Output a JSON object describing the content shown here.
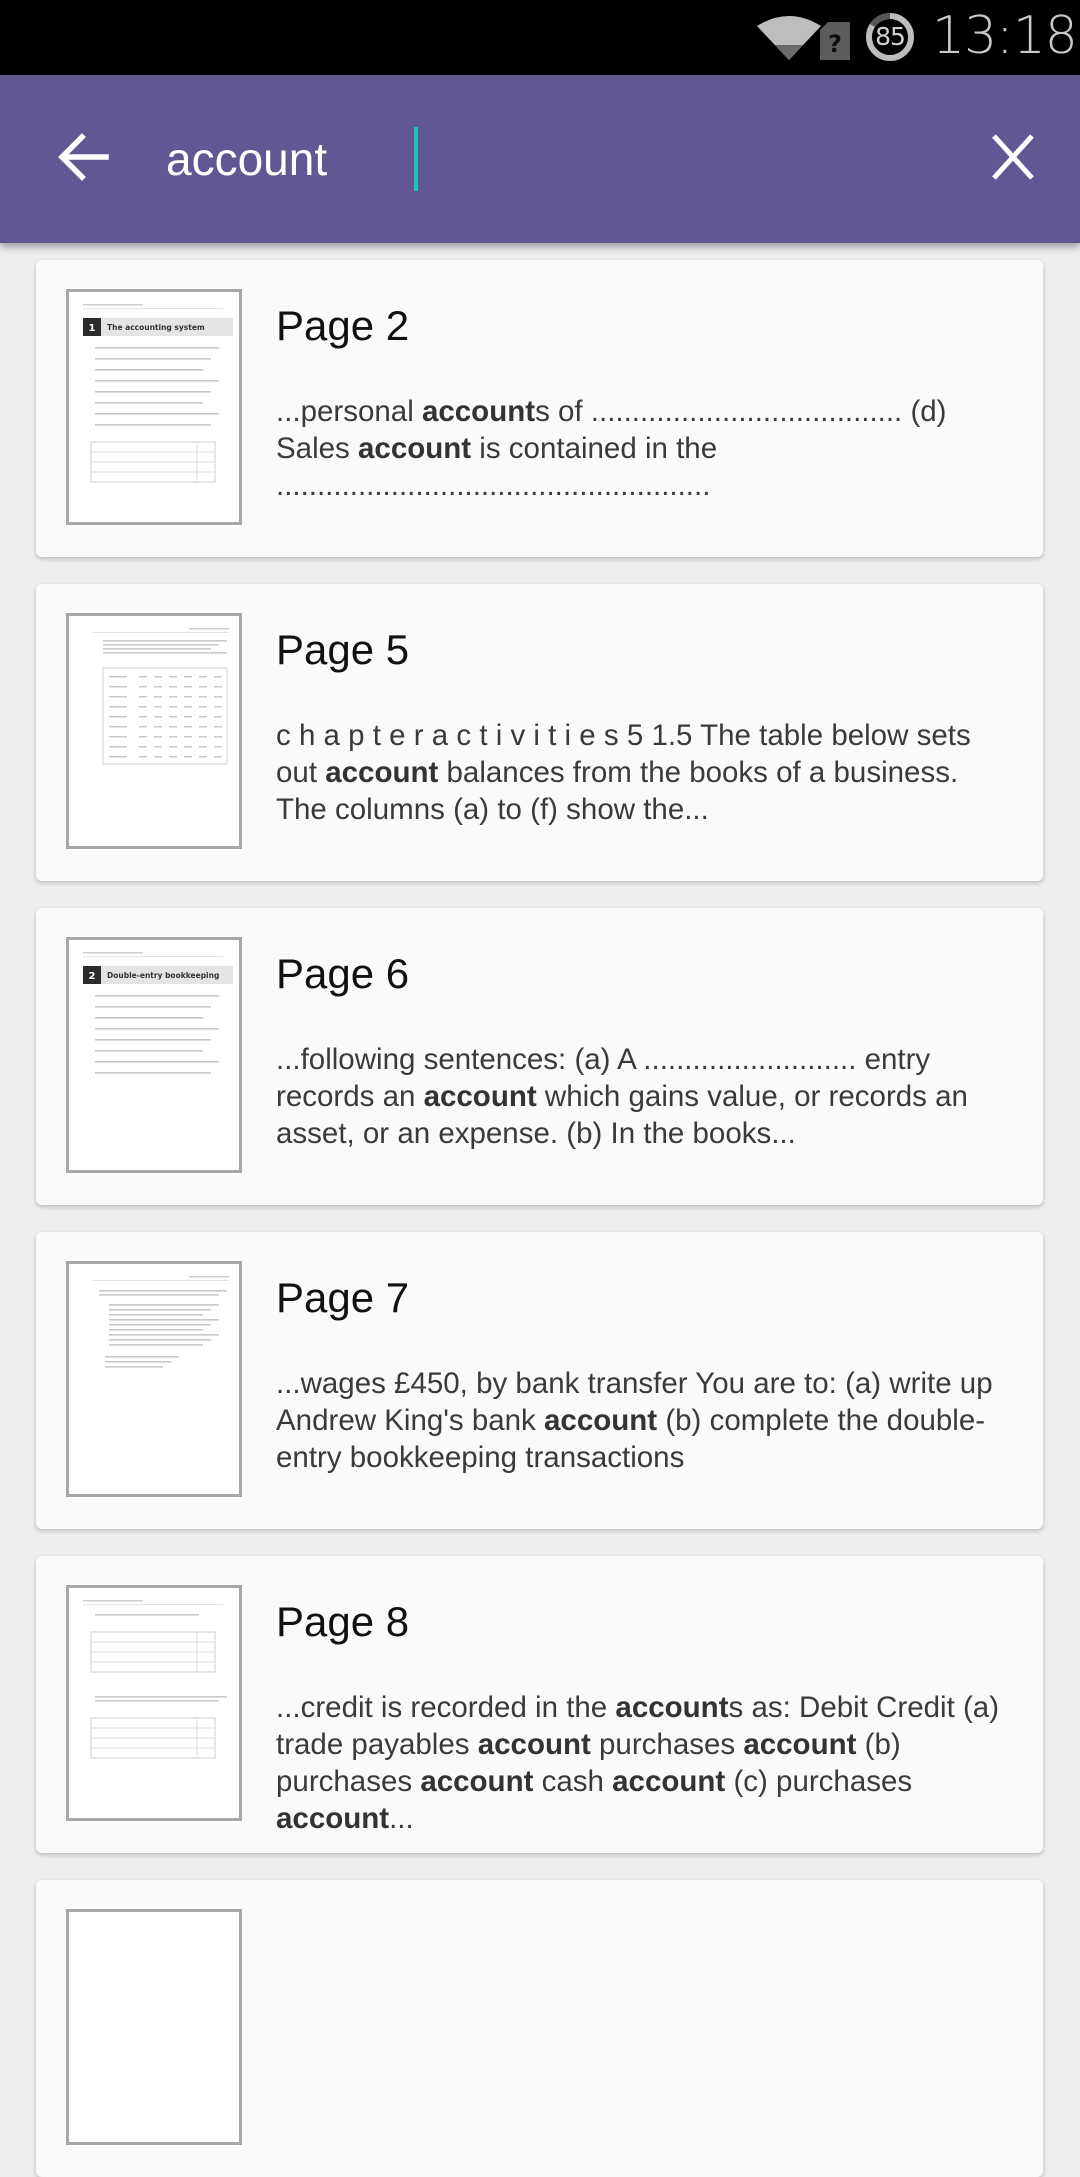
{
  "status_bar": {
    "battery_level": "85",
    "time": "13:18",
    "icons": [
      "wifi-icon",
      "sim-unknown-icon",
      "battery-icon"
    ]
  },
  "search": {
    "query": "account",
    "back_icon": "arrow-left-icon",
    "clear_icon": "close-icon"
  },
  "results": [
    {
      "title": "Page 2",
      "snippet": [
        {
          "t": "...personal "
        },
        {
          "t": "account",
          "b": true
        },
        {
          "t": "s of ...................................... (d) Sales "
        },
        {
          "t": "account",
          "b": true
        },
        {
          "t": " is contained in the ....................................................."
        }
      ],
      "thumb": {
        "kind": "chapter",
        "chapter_number": "1",
        "chapter_title": "The accounting system"
      }
    },
    {
      "title": "Page 5",
      "snippet": [
        {
          "t": "c h a p t e r a c t i v i t i e s 5 1.5 The table below sets out "
        },
        {
          "t": "account",
          "b": true
        },
        {
          "t": " balances from the books of a business. The columns (a) to (f) show the..."
        }
      ],
      "thumb": {
        "kind": "table"
      }
    },
    {
      "title": "Page 6",
      "snippet": [
        {
          "t": "...following sentences: (a) A .......................... entry records an "
        },
        {
          "t": "account",
          "b": true
        },
        {
          "t": " which gains value, or records an asset, or an expense. (b) In the books..."
        }
      ],
      "thumb": {
        "kind": "chapter",
        "chapter_number": "2",
        "chapter_title": "Double-entry bookkeeping"
      }
    },
    {
      "title": "Page 7",
      "snippet": [
        {
          "t": "...wages £450, by bank transfer You are to: (a) write up Andrew King's bank "
        },
        {
          "t": "account",
          "b": true
        },
        {
          "t": " (b) complete the double-entry bookkeeping transactions"
        }
      ],
      "thumb": {
        "kind": "list"
      }
    },
    {
      "title": "Page 8",
      "snippet": [
        {
          "t": "...credit is recorded in the "
        },
        {
          "t": "account",
          "b": true
        },
        {
          "t": "s as: Debit Credit (a) trade payables "
        },
        {
          "t": "account",
          "b": true
        },
        {
          "t": " purchases "
        },
        {
          "t": "account",
          "b": true
        },
        {
          "t": " (b) purchases "
        },
        {
          "t": "account",
          "b": true
        },
        {
          "t": " cash "
        },
        {
          "t": "account",
          "b": true
        },
        {
          "t": " (c) purchases "
        },
        {
          "t": "account",
          "b": true
        },
        {
          "t": "..."
        }
      ],
      "thumb": {
        "kind": "two-tables"
      }
    },
    {
      "title": "",
      "snippet": [],
      "thumb": {
        "kind": "blank"
      }
    }
  ]
}
